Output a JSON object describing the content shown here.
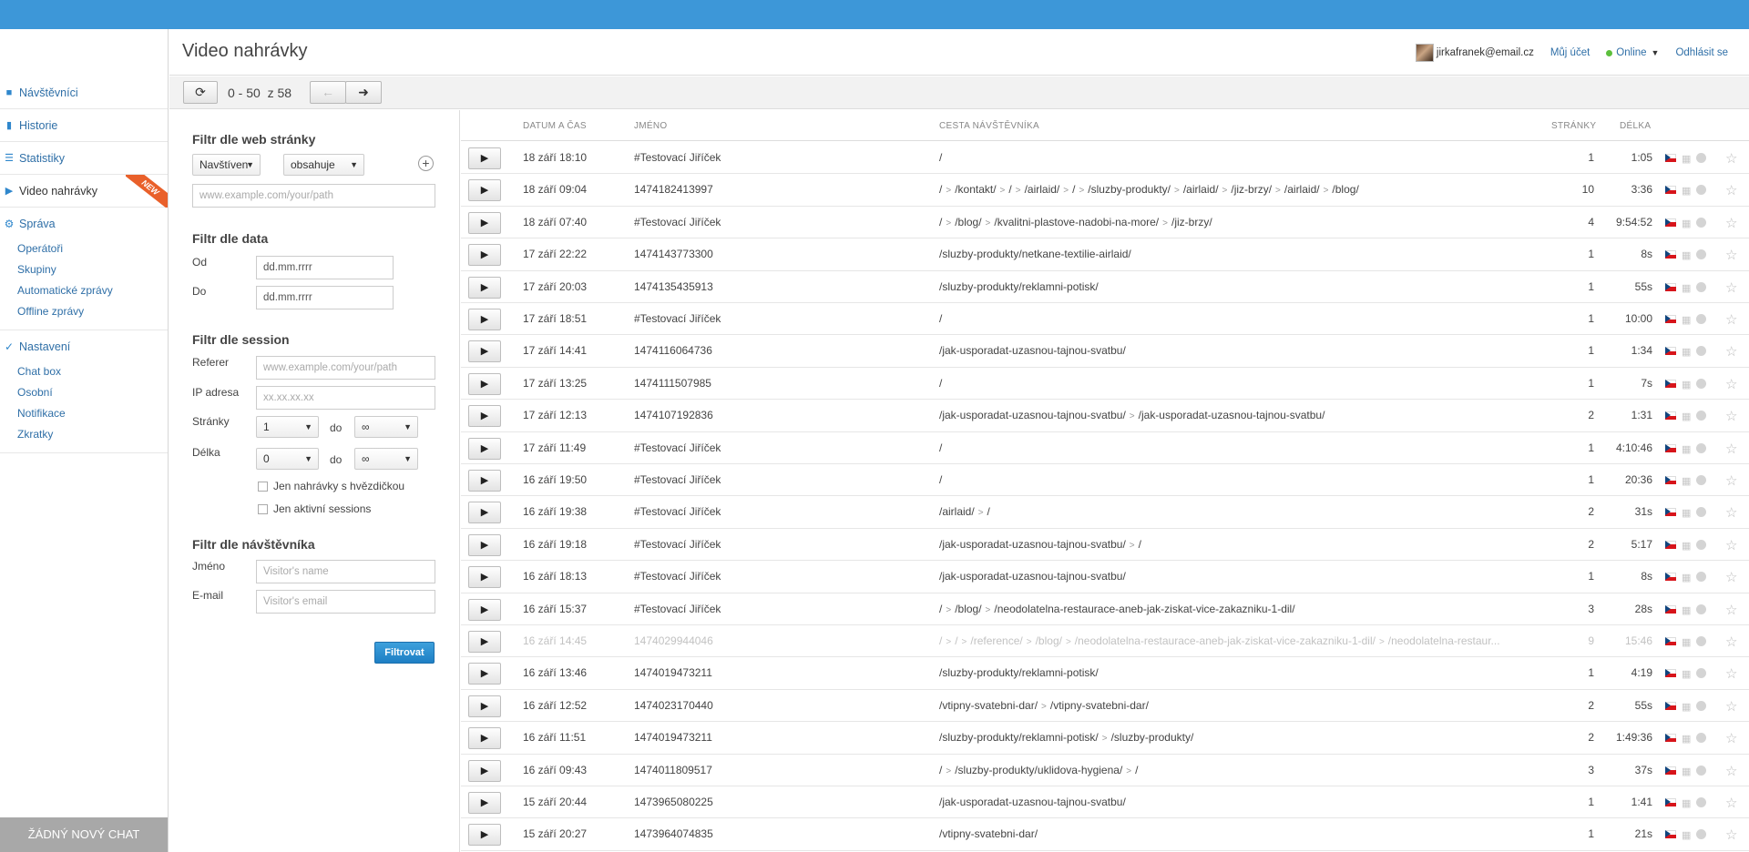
{
  "app": {
    "page_title": "Video nahrávky",
    "user_email": "jirkafranek@email.cz",
    "my_account": "Můj účet",
    "status": "Online",
    "logout": "Odhlásit se",
    "accent": "#3d97d8",
    "status_color": "#5cbf3c"
  },
  "sidebar": {
    "items": [
      {
        "label": "Návštěvníci",
        "icon": "chat-bubble-icon"
      },
      {
        "label": "Historie",
        "icon": "book-icon"
      },
      {
        "label": "Statistiky",
        "icon": "list-icon"
      },
      {
        "label": "Video nahrávky",
        "icon": "play-icon",
        "badge": "NEW"
      }
    ],
    "sprava": {
      "label": "Správa",
      "items": [
        "Operátoři",
        "Skupiny",
        "Automatické zprávy",
        "Offline zprávy"
      ]
    },
    "nastaveni": {
      "label": "Nastavení",
      "items": [
        "Chat box",
        "Osobní",
        "Notifikace",
        "Zkratky"
      ]
    },
    "footer": "ŽÁDNÝ NOVÝ CHAT"
  },
  "toolbar": {
    "range": "0 - 50",
    "total": "z 58",
    "refresh_icon": "refresh-icon",
    "prev_icon": "arrow-left-icon",
    "next_icon": "arrow-right-icon"
  },
  "filters": {
    "web": {
      "title": "Filtr dle web stránky",
      "select1": "Navštíven",
      "select2": "obsahuje",
      "placeholder": "www.example.com/your/path"
    },
    "date": {
      "title": "Filtr dle data",
      "from_label": "Od",
      "to_label": "Do",
      "from_value": "dd.mm.rrrr",
      "to_value": "dd.mm.rrrr"
    },
    "session": {
      "title": "Filtr dle session",
      "referer_label": "Referer",
      "referer_placeholder": "www.example.com/your/path",
      "ip_label": "IP adresa",
      "ip_placeholder": "xx.xx.xx.xx",
      "pages_label": "Stránky",
      "pages_from": "1",
      "pages_to": "∞",
      "length_label": "Délka",
      "length_from": "0",
      "length_to": "∞",
      "do_label": "do",
      "starred_only": "Jen nahrávky s hvězdičkou",
      "active_only": "Jen aktivní sessions"
    },
    "visitor": {
      "title": "Filtr dle návštěvníka",
      "name_label": "Jméno",
      "name_placeholder": "Visitor's name",
      "email_label": "E-mail",
      "email_placeholder": "Visitor's email"
    },
    "submit": "Filtrovat"
  },
  "table": {
    "headers": {
      "datetime": "DATUM A ČAS",
      "name": "JMÉNO",
      "path": "CESTA NÁVŠTĚVNÍKA",
      "pages": "STRÁNKY",
      "length": "DÉLKA"
    },
    "rows": [
      {
        "dt": "18 září 18:10",
        "name": "#Testovací Jiříček",
        "path": [
          "/"
        ],
        "pages": "1",
        "len": "1:05"
      },
      {
        "dt": "18 září 09:04",
        "name": "1474182413997",
        "path": [
          "/",
          "/kontakt/",
          "/",
          "/airlaid/",
          "/",
          "/sluzby-produkty/",
          "/airlaid/",
          "/jiz-brzy/",
          "/airlaid/",
          "/blog/"
        ],
        "pages": "10",
        "len": "3:36"
      },
      {
        "dt": "18 září 07:40",
        "name": "#Testovací Jiříček",
        "path": [
          "/",
          "/blog/",
          "/kvalitni-plastove-nadobi-na-more/",
          "/jiz-brzy/"
        ],
        "pages": "4",
        "len": "9:54:52"
      },
      {
        "dt": "17 září 22:22",
        "name": "1474143773300",
        "path": [
          "/sluzby-produkty/netkane-textilie-airlaid/"
        ],
        "pages": "1",
        "len": "8s"
      },
      {
        "dt": "17 září 20:03",
        "name": "1474135435913",
        "path": [
          "/sluzby-produkty/reklamni-potisk/"
        ],
        "pages": "1",
        "len": "55s"
      },
      {
        "dt": "17 září 18:51",
        "name": "#Testovací Jiříček",
        "path": [
          "/"
        ],
        "pages": "1",
        "len": "10:00"
      },
      {
        "dt": "17 září 14:41",
        "name": "1474116064736",
        "path": [
          "/jak-usporadat-uzasnou-tajnou-svatbu/"
        ],
        "pages": "1",
        "len": "1:34"
      },
      {
        "dt": "17 září 13:25",
        "name": "1474111507985",
        "path": [
          "/"
        ],
        "pages": "1",
        "len": "7s"
      },
      {
        "dt": "17 září 12:13",
        "name": "1474107192836",
        "path": [
          "/jak-usporadat-uzasnou-tajnou-svatbu/",
          "/jak-usporadat-uzasnou-tajnou-svatbu/"
        ],
        "pages": "2",
        "len": "1:31"
      },
      {
        "dt": "17 září 11:49",
        "name": "#Testovací Jiříček",
        "path": [
          "/"
        ],
        "pages": "1",
        "len": "4:10:46"
      },
      {
        "dt": "16 září 19:50",
        "name": "#Testovací Jiříček",
        "path": [
          "/"
        ],
        "pages": "1",
        "len": "20:36"
      },
      {
        "dt": "16 září 19:38",
        "name": "#Testovací Jiříček",
        "path": [
          "/airlaid/",
          "/"
        ],
        "pages": "2",
        "len": "31s"
      },
      {
        "dt": "16 září 19:18",
        "name": "#Testovací Jiříček",
        "path": [
          "/jak-usporadat-uzasnou-tajnou-svatbu/",
          "/"
        ],
        "pages": "2",
        "len": "5:17"
      },
      {
        "dt": "16 září 18:13",
        "name": "#Testovací Jiříček",
        "path": [
          "/jak-usporadat-uzasnou-tajnou-svatbu/"
        ],
        "pages": "1",
        "len": "8s"
      },
      {
        "dt": "16 září 15:37",
        "name": "#Testovací Jiříček",
        "path": [
          "/",
          "/blog/",
          "/neodolatelna-restaurace-aneb-jak-ziskat-vice-zakazniku-1-dil/"
        ],
        "pages": "3",
        "len": "28s"
      },
      {
        "dt": "16 září 14:45",
        "name": "1474029944046",
        "path": [
          "/",
          "/",
          "/reference/",
          "/blog/",
          "/neodolatelna-restaurace-aneb-jak-ziskat-vice-zakazniku-1-dil/",
          "/neodolatelna-restaur..."
        ],
        "pages": "9",
        "len": "15:46",
        "dim": true
      },
      {
        "dt": "16 září 13:46",
        "name": "1474019473211",
        "path": [
          "/sluzby-produkty/reklamni-potisk/"
        ],
        "pages": "1",
        "len": "4:19"
      },
      {
        "dt": "16 září 12:52",
        "name": "1474023170440",
        "path": [
          "/vtipny-svatebni-dar/",
          "/vtipny-svatebni-dar/"
        ],
        "pages": "2",
        "len": "55s"
      },
      {
        "dt": "16 září 11:51",
        "name": "1474019473211",
        "path": [
          "/sluzby-produkty/reklamni-potisk/",
          "/sluzby-produkty/"
        ],
        "pages": "2",
        "len": "1:49:36"
      },
      {
        "dt": "16 září 09:43",
        "name": "1474011809517",
        "path": [
          "/",
          "/sluzby-produkty/uklidova-hygiena/",
          "/"
        ],
        "pages": "3",
        "len": "37s"
      },
      {
        "dt": "15 září 20:44",
        "name": "1473965080225",
        "path": [
          "/jak-usporadat-uzasnou-tajnou-svatbu/"
        ],
        "pages": "1",
        "len": "1:41"
      },
      {
        "dt": "15 září 20:27",
        "name": "1473964074835",
        "path": [
          "/vtipny-svatebni-dar/"
        ],
        "pages": "1",
        "len": "21s"
      }
    ]
  }
}
